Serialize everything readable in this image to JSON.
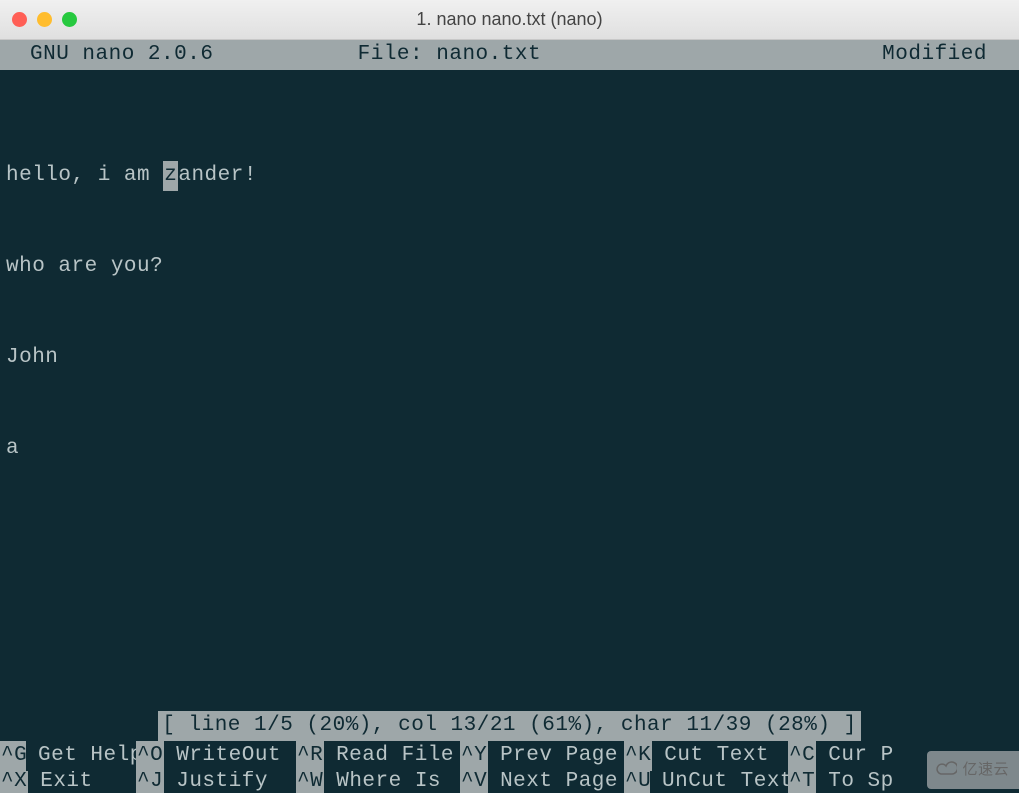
{
  "window": {
    "title": "1. nano nano.txt (nano)"
  },
  "header": {
    "app": "GNU nano 2.0.6",
    "file": "File: nano.txt",
    "status": "Modified"
  },
  "content": {
    "line1_before": "hello, i am ",
    "line1_cursor": "z",
    "line1_after": "ander!",
    "line2": "who are you?",
    "line3": "John",
    "line4": "a"
  },
  "status_line": "[ line 1/5 (20%), col 13/21 (61%), char 11/39 (28%) ]",
  "shortcuts_row1": [
    {
      "key": "^G",
      "label": "Get Help"
    },
    {
      "key": "^O",
      "label": "WriteOut"
    },
    {
      "key": "^R",
      "label": "Read File"
    },
    {
      "key": "^Y",
      "label": "Prev Page"
    },
    {
      "key": "^K",
      "label": "Cut Text"
    },
    {
      "key": "^C",
      "label": "Cur P"
    }
  ],
  "shortcuts_row2": [
    {
      "key": "^X",
      "label": "Exit"
    },
    {
      "key": "^J",
      "label": "Justify"
    },
    {
      "key": "^W",
      "label": "Where Is"
    },
    {
      "key": "^V",
      "label": "Next Page"
    },
    {
      "key": "^U",
      "label": "UnCut Text"
    },
    {
      "key": "^T",
      "label": "To Sp"
    }
  ],
  "watermark": "亿速云",
  "shortcut_widths": [
    136,
    160,
    164,
    164,
    164,
    160
  ]
}
